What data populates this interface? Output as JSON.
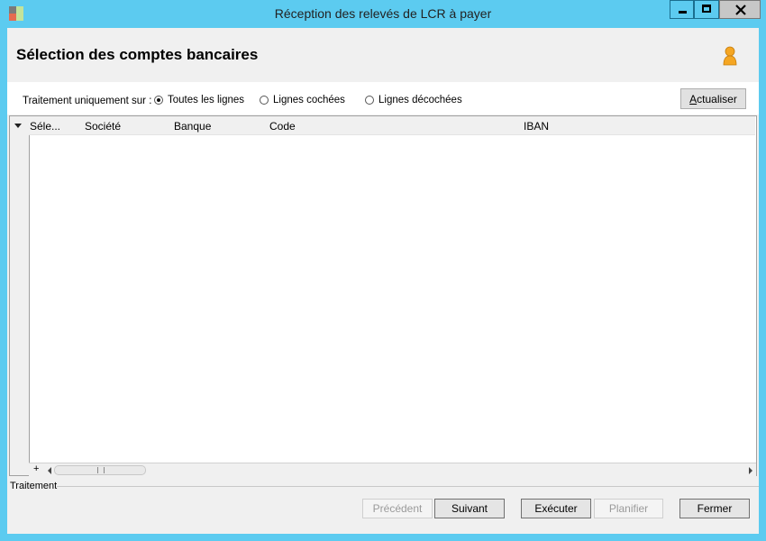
{
  "window": {
    "title": "Réception des relevés de LCR à payer",
    "controls": {
      "minimize": "minimize",
      "maximize": "maximize",
      "close": "close"
    }
  },
  "header": {
    "title": "Sélection des comptes bancaires",
    "icon": "user-icon"
  },
  "filter": {
    "label": "Traitement uniquement sur :",
    "options": [
      {
        "label": "Toutes les lignes",
        "selected": true
      },
      {
        "label": "Lignes cochées",
        "selected": false
      },
      {
        "label": "Lignes décochées",
        "selected": false
      }
    ],
    "refresh_button": {
      "first": "A",
      "rest": "ctualiser"
    }
  },
  "grid": {
    "columns": [
      "Séle...",
      "Société",
      "Banque",
      "Code",
      "IBAN"
    ],
    "rows": [],
    "footer": {
      "add": "+"
    }
  },
  "section": {
    "label": "Traitement"
  },
  "buttons": {
    "previous": "Précédent",
    "next": "Suivant",
    "execute": "Exécuter",
    "schedule": "Planifier",
    "close": "Fermer"
  },
  "colors": {
    "titlebar": "#5ccbf0",
    "panel": "#f0f0f0",
    "accent_user": "#f5a623"
  }
}
